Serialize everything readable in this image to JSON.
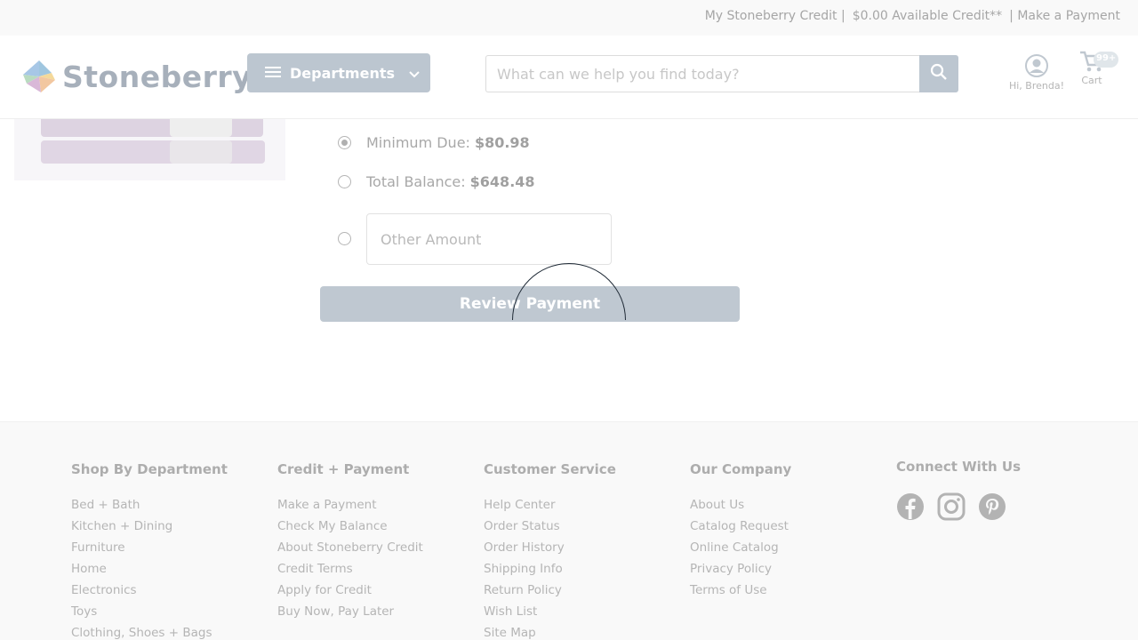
{
  "topbar": {
    "credit_link": "My Stoneberry Credit |",
    "available": "$0.00 Available Credit**",
    "make_payment": "| Make a Payment"
  },
  "header": {
    "logo_text": "Stoneberry",
    "departments_label": "Departments",
    "search_placeholder": "What can we help you find today?",
    "account_label": "Hi, Brenda!",
    "cart_label": "Cart",
    "cart_count": "99+"
  },
  "payment": {
    "options": [
      {
        "label": "Minimum Due:",
        "amount": "$80.98",
        "checked": true
      },
      {
        "label": "Total Balance:",
        "amount": "$648.48",
        "checked": false
      }
    ],
    "other_placeholder": "Other Amount",
    "review_button": "Review Payment"
  },
  "footer": {
    "columns": [
      {
        "title": "Shop By Department",
        "items": [
          "Bed + Bath",
          "Kitchen + Dining",
          "Furniture",
          "Home",
          "Electronics",
          "Toys",
          "Clothing, Shoes + Bags"
        ]
      },
      {
        "title": "Credit + Payment",
        "items": [
          "Make a Payment",
          "Check My Balance",
          "About Stoneberry Credit",
          "Credit Terms",
          "Apply for Credit",
          "Buy Now, Pay Later"
        ]
      },
      {
        "title": "Customer Service",
        "items": [
          "Help Center",
          "Order Status",
          "Order History",
          "Shipping Info",
          "Return Policy",
          "Wish List",
          "Site Map"
        ]
      },
      {
        "title": "Our Company",
        "items": [
          "About Us",
          "Catalog Request",
          "Online Catalog",
          "Privacy Policy",
          "Terms of Use"
        ]
      }
    ],
    "connect_title": "Connect With Us",
    "social_icons": [
      "facebook-icon",
      "instagram-icon",
      "pinterest-icon"
    ]
  },
  "colors": {
    "accent": "#bcc6d0",
    "spinner": "#1f2a36"
  }
}
